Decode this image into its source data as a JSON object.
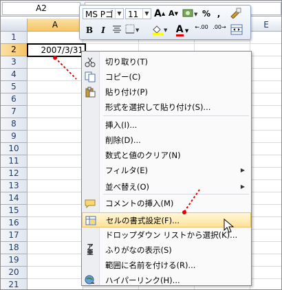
{
  "name_box": "A2",
  "columns": [
    "A",
    "E"
  ],
  "rows": [
    "1",
    "2",
    "3",
    "4",
    "5",
    "6",
    "7",
    "8",
    "9",
    "10",
    "11",
    "12",
    "13",
    "14",
    "15",
    "16",
    "17",
    "18",
    "19",
    "20",
    "21"
  ],
  "selected_row": "2",
  "selected_column": "A",
  "cell_a2_value": "2007/3/31",
  "mini_toolbar": {
    "font_name": "MS Pゴ",
    "font_size": "11",
    "grow_font": "A",
    "shrink_font": "A",
    "percent": "%",
    "comma": ",",
    "bold": "B",
    "italic": "I",
    "font_color_glyph": "A",
    "increase_decimal": "←.00",
    "decrease_decimal": ".00→"
  },
  "menu": {
    "items": [
      {
        "label": "切り取り(T)",
        "icon": "scissors-icon"
      },
      {
        "label": "コピー(C)",
        "icon": "copy-icon"
      },
      {
        "label": "貼り付け(P)",
        "icon": "paste-icon"
      },
      {
        "label": "形式を選択して貼り付け(S)...",
        "icon": ""
      },
      {
        "label": "挿入(I)...",
        "icon": ""
      },
      {
        "label": "削除(D)...",
        "icon": ""
      },
      {
        "label": "数式と値のクリア(N)",
        "icon": ""
      },
      {
        "label": "フィルタ(E)",
        "icon": "",
        "submenu": true
      },
      {
        "label": "並べ替え(O)",
        "icon": "",
        "submenu": true
      },
      {
        "label": "コメントの挿入(M)",
        "icon": "comment-icon"
      },
      {
        "label": "セルの書式設定(F)...",
        "icon": "format-cells-icon"
      },
      {
        "label": "ドロップダウン リストから選択(K)...",
        "icon": ""
      },
      {
        "label": "ふりがなの表示(S)",
        "icon": "furigana-icon"
      },
      {
        "label": "範囲に名前を付ける(R)...",
        "icon": ""
      },
      {
        "label": "ハイパーリンク(H)...",
        "icon": "hyperlink-icon"
      }
    ],
    "highlighted_index": 10,
    "furigana_icon_text": "ア亜"
  },
  "colors": {
    "selection_header": "#f5c466",
    "highlight": "#ffe39a",
    "annotation_dot": "#e00000"
  }
}
